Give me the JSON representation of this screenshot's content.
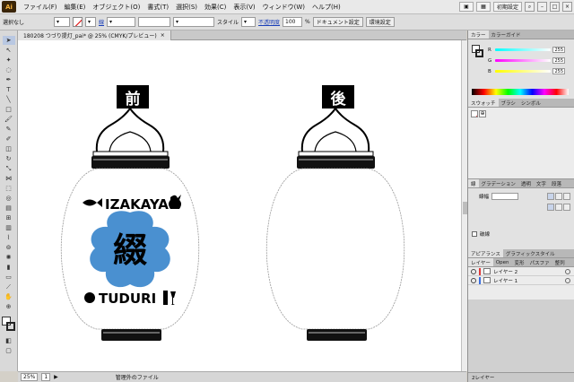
{
  "app": {
    "logo": "Ai"
  },
  "menu": {
    "items": [
      "ファイル(F)",
      "編集(E)",
      "オブジェクト(O)",
      "書式(T)",
      "選択(S)",
      "効果(C)",
      "表示(V)",
      "ウィンドウ(W)",
      "ヘルプ(H)"
    ],
    "workspace": "初期設定"
  },
  "control_bar": {
    "selection_status": "選択なし",
    "stroke_label": "線",
    "style_label": "スタイル",
    "opacity_label": "不透明度",
    "opacity_value": "100",
    "opacity_unit": "%",
    "document_setup": "ドキュメント設定",
    "preferences": "環境設定"
  },
  "document_tab": {
    "title": "180208 つづり提灯_pai* @ 25% (CMYK/プレビュー)",
    "close": "×"
  },
  "canvas": {
    "front_label": "前",
    "back_label": "後",
    "brand_top": "IZAKAYA",
    "brand_bottom": "TUDURI",
    "emblem_char": "綴"
  },
  "panels": {
    "color": {
      "tabs": [
        "カラー",
        "カラーガイド"
      ],
      "r": "255",
      "g": "255",
      "b": "255",
      "r_label": "R",
      "g_label": "G",
      "b_label": "B"
    },
    "swatch": {
      "tabs": [
        "スウォッチ",
        "ブラシ",
        "シンボル"
      ]
    },
    "stroke": {
      "tabs": [
        "線",
        "グラデーション",
        "透明",
        "文字",
        "段落"
      ],
      "width_label": "線幅",
      "dash_label": "破線"
    },
    "appearance": {
      "tabs": [
        "アピアランス",
        "グラフィックスタイル"
      ]
    },
    "layers": {
      "tabs": [
        "レイヤー",
        "Open",
        "変形",
        "パスファ",
        "整列"
      ],
      "items": [
        {
          "name": "レイヤー 2",
          "color": "#e03a3a"
        },
        {
          "name": "レイヤー 1",
          "color": "#3a6ee0"
        }
      ],
      "footer": "2レイヤー"
    }
  },
  "status_bar": {
    "zoom": "25%",
    "artboard": "1",
    "info": "管理外のファイル"
  },
  "colors": {
    "emblem_blue": "#4a90d0",
    "ink": "#000000"
  }
}
